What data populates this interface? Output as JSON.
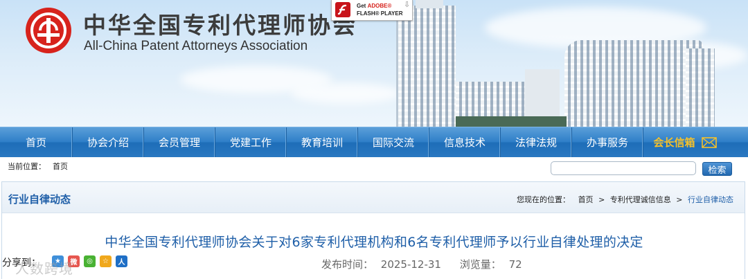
{
  "header": {
    "org_name_cn": "中华全国专利代理师协会",
    "org_name_en": "All-China Patent Attorneys Association",
    "flash_badge": {
      "get": "Get",
      "brand": "ADOBE®",
      "product": "FLASH® PLAYER"
    }
  },
  "nav": {
    "items": [
      {
        "label": "首页"
      },
      {
        "label": "协会介绍"
      },
      {
        "label": "会员管理"
      },
      {
        "label": "党建工作"
      },
      {
        "label": "教育培训"
      },
      {
        "label": "国际交流"
      },
      {
        "label": "信息技术"
      },
      {
        "label": "法律法规"
      },
      {
        "label": "办事服务"
      }
    ],
    "special": {
      "label": "会长信箱",
      "color": "#f6c12a"
    }
  },
  "location": {
    "label": "当前位置：",
    "current": "首页",
    "search_value": "",
    "search_button": "检索"
  },
  "section": {
    "title": "行业自律动态",
    "breadcrumb_label": "您现在的位置：",
    "breadcrumb": [
      "首页",
      "专利代理诚信信息",
      "行业自律动态"
    ]
  },
  "article": {
    "title": "中华全国专利代理师协会关于对6家专利代理机构和6名专利代理师予以行业自律处理的决定",
    "share_label": "分享到：",
    "share_icons": [
      "qzone-icon",
      "weibo-icon",
      "wechat-icon",
      "favorite-icon",
      "renren-icon"
    ],
    "publish_label": "发布时间：",
    "publish_date": "2025-12-31",
    "views_label": "浏览量：",
    "views": "72"
  },
  "watermark": "人数跨境",
  "colors": {
    "brand_blue": "#1f5fa8",
    "nav_blue": "#2f7fc8",
    "logo_red": "#d7231c"
  }
}
